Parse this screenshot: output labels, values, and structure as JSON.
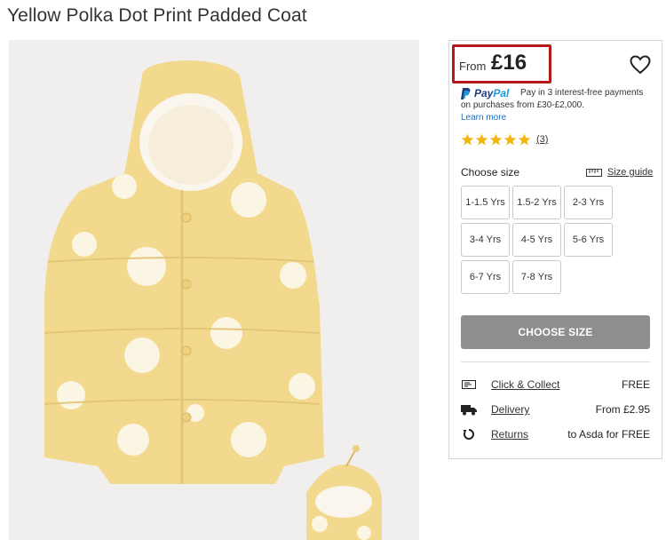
{
  "product": {
    "title": "Yellow Polka Dot Print Padded Coat"
  },
  "price": {
    "prefix": "From",
    "value": "£16"
  },
  "paypal": {
    "brand_a": "Pay",
    "brand_b": "Pal",
    "line1": "Pay in 3 interest-free payments",
    "line2": "on purchases from £30-£2,000.",
    "learn_more": "Learn more"
  },
  "rating": {
    "stars": 5,
    "count": "(3)",
    "star_color": "#f5b60a"
  },
  "sizes": {
    "label": "Choose size",
    "guide": "Size guide",
    "options": [
      "1-1.5 Yrs",
      "1.5-2 Yrs",
      "2-3 Yrs",
      "3-4 Yrs",
      "4-5 Yrs",
      "5-6 Yrs",
      "6-7 Yrs",
      "7-8 Yrs"
    ]
  },
  "cta": {
    "label": "CHOOSE SIZE",
    "color": "#8e8e8e"
  },
  "fulfilment": [
    {
      "icon": "click-collect-icon",
      "label": "Click & Collect",
      "value": "FREE"
    },
    {
      "icon": "delivery-truck-icon",
      "label": "Delivery",
      "value": "From £2.95"
    },
    {
      "icon": "returns-icon",
      "label": "Returns",
      "value": "to Asda for FREE"
    }
  ],
  "colors": {
    "price_highlight": "#b31b1b",
    "link": "#1a6ec2",
    "coat": "#f3d98e",
    "dots": "#fbf5e4"
  }
}
